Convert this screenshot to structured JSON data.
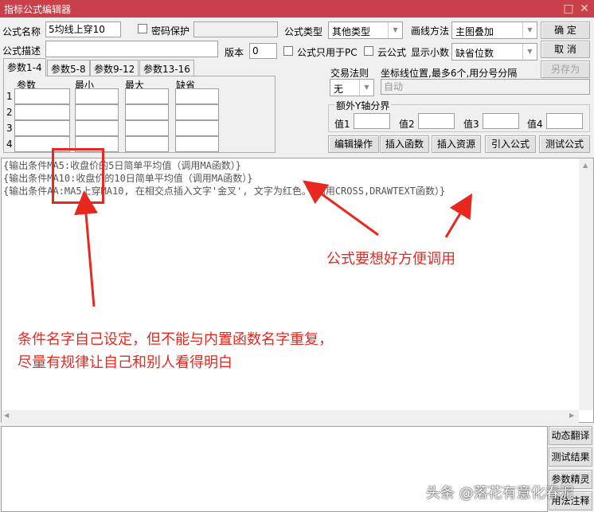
{
  "window": {
    "title": "指标公式编辑器"
  },
  "form": {
    "name_label": "公式名称",
    "name_value": "5均线上穿10",
    "password_label": "密码保护",
    "type_label": "公式类型",
    "type_value": "其他类型",
    "draw_label": "画线方法",
    "draw_value": "主图叠加",
    "desc_label": "公式描述",
    "desc_value": "",
    "version_label": "版本",
    "version_value": "0",
    "pc_only_label": "公式只用于PC",
    "cloud_label": "云公式",
    "decimal_label": "显示小数",
    "decimal_value": "缺省位数"
  },
  "buttons": {
    "ok": "确  定",
    "cancel": "取  消",
    "save_as": "另存为"
  },
  "tabs": [
    "参数1-4",
    "参数5-8",
    "参数9-12",
    "参数13-16"
  ],
  "params": {
    "headers": [
      "参数",
      "最小",
      "最大",
      "缺省"
    ],
    "rows": [
      "1",
      "2",
      "3",
      "4"
    ]
  },
  "trade": {
    "label": "交易法则",
    "value": "无"
  },
  "axis": {
    "label": "坐标线位置,最多6个,用分号分隔",
    "placeholder": "自动"
  },
  "yaxis": {
    "label": "额外Y轴分界",
    "values": [
      "值1",
      "值2",
      "值3",
      "值4"
    ]
  },
  "toolbar": [
    "编辑操作",
    "插入函数",
    "插入资源",
    "引入公式",
    "测试公式"
  ],
  "code_lines": [
    "{输出条件MA5:收盘价的5日简单平均值（调用MA函数）}",
    "{输出条件MA10:收盘价的10日简单平均值（调用MA函数）}",
    "{输出条件AA:MA5上穿MA10, 在相交点插入文字'金叉', 文字为红色。（调用CROSS,DRAWTEXT函数）}"
  ],
  "side_buttons": [
    "动态翻译",
    "测试结果",
    "参数精灵",
    "用法注释"
  ],
  "annotations": {
    "call_note": "公式要想好方便调用",
    "name_note_1": "条件名字自己设定，但不能与内置函数名字重复，",
    "name_note_2": "尽量有规律让自己和别人看得明白"
  },
  "watermark": "头条 @落花有意化春泥",
  "colors": {
    "titlebar": "#c9404a",
    "annotation": "#e8281e"
  }
}
